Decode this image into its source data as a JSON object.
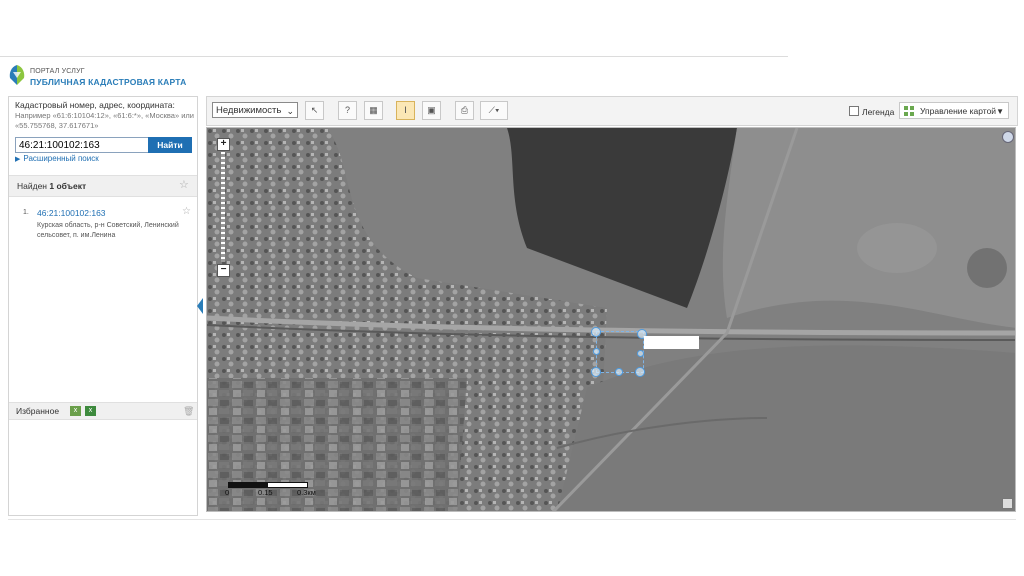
{
  "header": {
    "portal_label": "ПОРТАЛ УСЛУГ",
    "title": "ПУБЛИЧНАЯ КАДАСТРОВАЯ КАРТА"
  },
  "search": {
    "heading": "Кадастровый номер, адрес, координата:",
    "example": "Например «61:6:10104:12», «61:6:*», «Москва» или «55.755768, 37.617671»",
    "value": "46:21:100102:163",
    "button_label": "Найти",
    "advanced_label": "Расширенный поиск"
  },
  "results": {
    "found_prefix": "Найден ",
    "found_count": "1",
    "found_suffix": " объект",
    "items": [
      {
        "number": "1.",
        "cadastral_number": "46:21:100102:163",
        "address": "Курская область, р-н Советский, Ленинский сельсовет, п. им.Ленина"
      }
    ]
  },
  "favorites": {
    "label": "Избранное"
  },
  "toolbar": {
    "layer_select": "Недвижимость",
    "legend_label": "Легенда",
    "legend_checked": false,
    "map_control_label": "Управление картой"
  },
  "map": {
    "scale_labels": [
      "0",
      "0.15",
      "0.3км"
    ]
  },
  "colors": {
    "brand_blue": "#2a7db8",
    "button_blue": "#1f6fb3",
    "active_tool": "#fbe7b5",
    "selection_handle": "#4e9be0"
  }
}
